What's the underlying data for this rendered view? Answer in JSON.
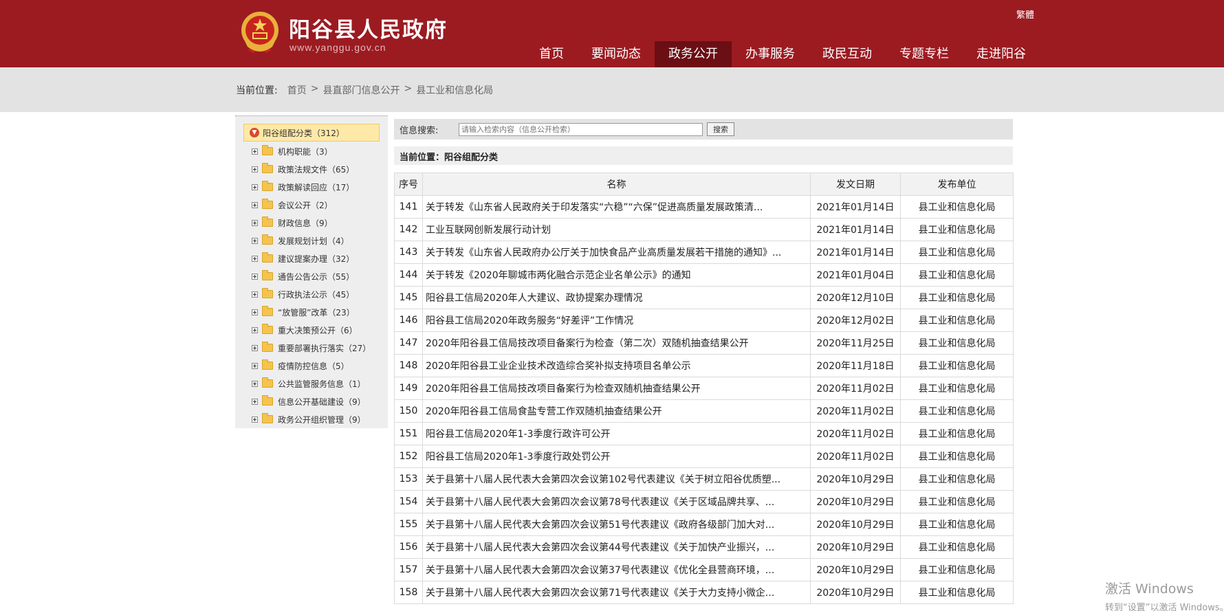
{
  "header": {
    "title": "阳谷县人民政府",
    "url": "www.yanggu.gov.cn",
    "lang_switch": "繁體",
    "nav": [
      "首页",
      "要闻动态",
      "政务公开",
      "办事服务",
      "政民互动",
      "专题专栏",
      "走进阳谷"
    ],
    "nav_active_index": 2,
    "colors": {
      "brand": "#9b1b21",
      "nav_active": "#6b0f14"
    }
  },
  "breadcrumb": {
    "label": "当前位置:",
    "items": [
      "首页",
      "县直部门信息公开",
      "县工业和信息化局"
    ],
    "separator": ">"
  },
  "sidebar": {
    "root": "阳谷组配分类（312）",
    "items": [
      "机构职能（3）",
      "政策法规文件（65）",
      "政策解读回应（17）",
      "会议公开（2）",
      "财政信息（9）",
      "发展规划计划（4）",
      "建议提案办理（32）",
      "通告公告公示（55）",
      "行政执法公示（45）",
      "“放管服”改革（23）",
      "重大决策预公开（6）",
      "重要部署执行落实（27）",
      "疫情防控信息（5）",
      "公共监管服务信息（1）",
      "信息公开基础建设（9）",
      "政务公开组织管理（9）"
    ]
  },
  "search": {
    "label": "信息搜索:",
    "placeholder": "请输入检索内容（信息公开检索）",
    "button": "搜索"
  },
  "location": {
    "text": "当前位置：阳谷组配分类"
  },
  "table": {
    "headers": [
      "序号",
      "名称",
      "发文日期",
      "发布单位"
    ],
    "rows": [
      [
        "141",
        "关于转发《山东省人民政府关于印发落实“六稳”“六保”促进高质量发展政策清...",
        "2021年01月14日",
        "县工业和信息化局"
      ],
      [
        "142",
        "工业互联网创新发展行动计划",
        "2021年01月14日",
        "县工业和信息化局"
      ],
      [
        "143",
        "关于转发《山东省人民政府办公厅关于加快食品产业高质量发展若干措施的通知》...",
        "2021年01月14日",
        "县工业和信息化局"
      ],
      [
        "144",
        "关于转发《2020年聊城市两化融合示范企业名单公示》的通知",
        "2021年01月04日",
        "县工业和信息化局"
      ],
      [
        "145",
        "阳谷县工信局2020年人大建议、政协提案办理情况",
        "2020年12月10日",
        "县工业和信息化局"
      ],
      [
        "146",
        "阳谷县工信局2020年政务服务“好差评”工作情况",
        "2020年12月02日",
        "县工业和信息化局"
      ],
      [
        "147",
        "2020年阳谷县工信局技改项目备案行为检查（第二次）双随机抽查结果公开",
        "2020年11月25日",
        "县工业和信息化局"
      ],
      [
        "148",
        "2020年阳谷县工业企业技术改造综合奖补拟支持项目名单公示",
        "2020年11月18日",
        "县工业和信息化局"
      ],
      [
        "149",
        "2020年阳谷县工信局技改项目备案行为检查双随机抽查结果公开",
        "2020年11月02日",
        "县工业和信息化局"
      ],
      [
        "150",
        "2020年阳谷县工信局食盐专营工作双随机抽查结果公开",
        "2020年11月02日",
        "县工业和信息化局"
      ],
      [
        "151",
        "阳谷县工信局2020年1-3季度行政许可公开",
        "2020年11月02日",
        "县工业和信息化局"
      ],
      [
        "152",
        "阳谷县工信局2020年1-3季度行政处罚公开",
        "2020年11月02日",
        "县工业和信息化局"
      ],
      [
        "153",
        "关于县第十八届人民代表大会第四次会议第102号代表建议《关于树立阳谷优质塑...",
        "2020年10月29日",
        "县工业和信息化局"
      ],
      [
        "154",
        "关于县第十八届人民代表大会第四次会议第78号代表建议《关于区域品牌共享、...",
        "2020年10月29日",
        "县工业和信息化局"
      ],
      [
        "155",
        "关于县第十八届人民代表大会第四次会议第51号代表建议《政府各级部门加大对...",
        "2020年10月29日",
        "县工业和信息化局"
      ],
      [
        "156",
        "关于县第十八届人民代表大会第四次会议第44号代表建议《关于加快产业振兴，...",
        "2020年10月29日",
        "县工业和信息化局"
      ],
      [
        "157",
        "关于县第十八届人民代表大会第四次会议第37号代表建议《优化全县营商环境，...",
        "2020年10月29日",
        "县工业和信息化局"
      ],
      [
        "158",
        "关于县第十八届人民代表大会第四次会议第71号代表建议《关于大力支持小微企...",
        "2020年10月29日",
        "县工业和信息化局"
      ]
    ]
  },
  "watermark": {
    "line1": "激活 Windows",
    "line2": "转到“设置”以激活 Windows。"
  }
}
